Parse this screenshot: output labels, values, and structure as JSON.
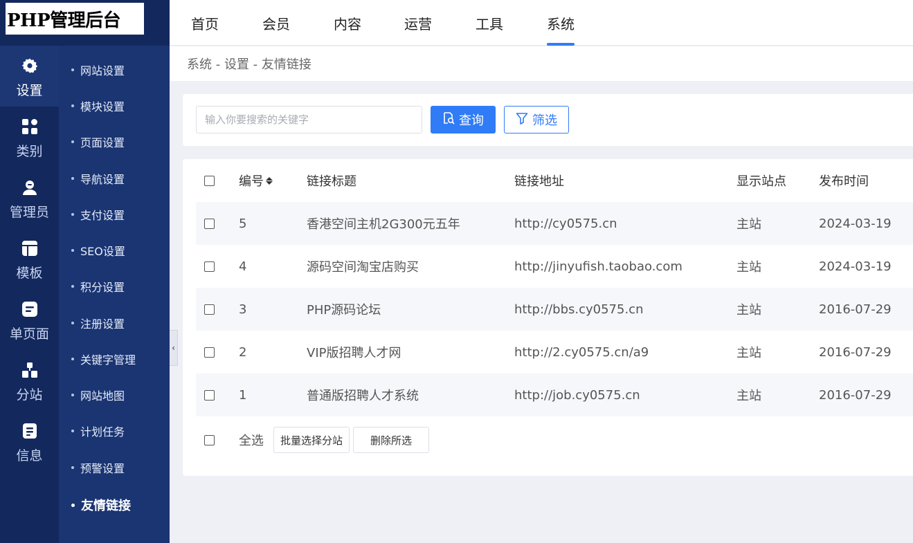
{
  "app": {
    "logo_text": "PHP管理后台"
  },
  "rail": [
    {
      "label": "设置",
      "icon": "gear-icon"
    },
    {
      "label": "类别",
      "icon": "category-icon"
    },
    {
      "label": "管理员",
      "icon": "admin-user-icon"
    },
    {
      "label": "模板",
      "icon": "template-icon"
    },
    {
      "label": "单页面",
      "icon": "single-page-icon"
    },
    {
      "label": "分站",
      "icon": "substation-icon"
    },
    {
      "label": "信息",
      "icon": "info-icon"
    }
  ],
  "submenu": [
    "网站设置",
    "模块设置",
    "页面设置",
    "导航设置",
    "支付设置",
    "SEO设置",
    "积分设置",
    "注册设置",
    "关键字管理",
    "网站地图",
    "计划任务",
    "预警设置",
    "友情链接"
  ],
  "topnav": [
    "首页",
    "会员",
    "内容",
    "运营",
    "工具",
    "系统"
  ],
  "breadcrumb": "系统 - 设置 - 友情链接",
  "search": {
    "placeholder": "输入你要搜索的关键字",
    "query_label": "查询",
    "filter_label": "筛选"
  },
  "table": {
    "headers": {
      "id": "编号",
      "title": "链接标题",
      "url": "链接地址",
      "site": "显示站点",
      "date": "发布时间"
    },
    "rows": [
      {
        "id": "5",
        "title": "香港空间主机2G300元五年",
        "url": "http://cy0575.cn",
        "site": "主站",
        "date": "2024-03-19"
      },
      {
        "id": "4",
        "title": "源码空间淘宝店购买",
        "url": "http://jinyufish.taobao.com",
        "site": "主站",
        "date": "2024-03-19"
      },
      {
        "id": "3",
        "title": "PHP源码论坛",
        "url": "http://bbs.cy0575.cn",
        "site": "主站",
        "date": "2016-07-29"
      },
      {
        "id": "2",
        "title": "VIP版招聘人才网",
        "url": "http://2.cy0575.cn/a9",
        "site": "主站",
        "date": "2016-07-29"
      },
      {
        "id": "1",
        "title": "普通版招聘人才系统",
        "url": "http://job.cy0575.cn",
        "site": "主站",
        "date": "2016-07-29"
      }
    ]
  },
  "footer": {
    "select_all": "全选",
    "batch_site": "批量选择分站",
    "delete_selected": "删除所选"
  },
  "colors": {
    "primary": "#2f7cf6",
    "rail": "#13285c",
    "submenu": "#1a3572"
  }
}
